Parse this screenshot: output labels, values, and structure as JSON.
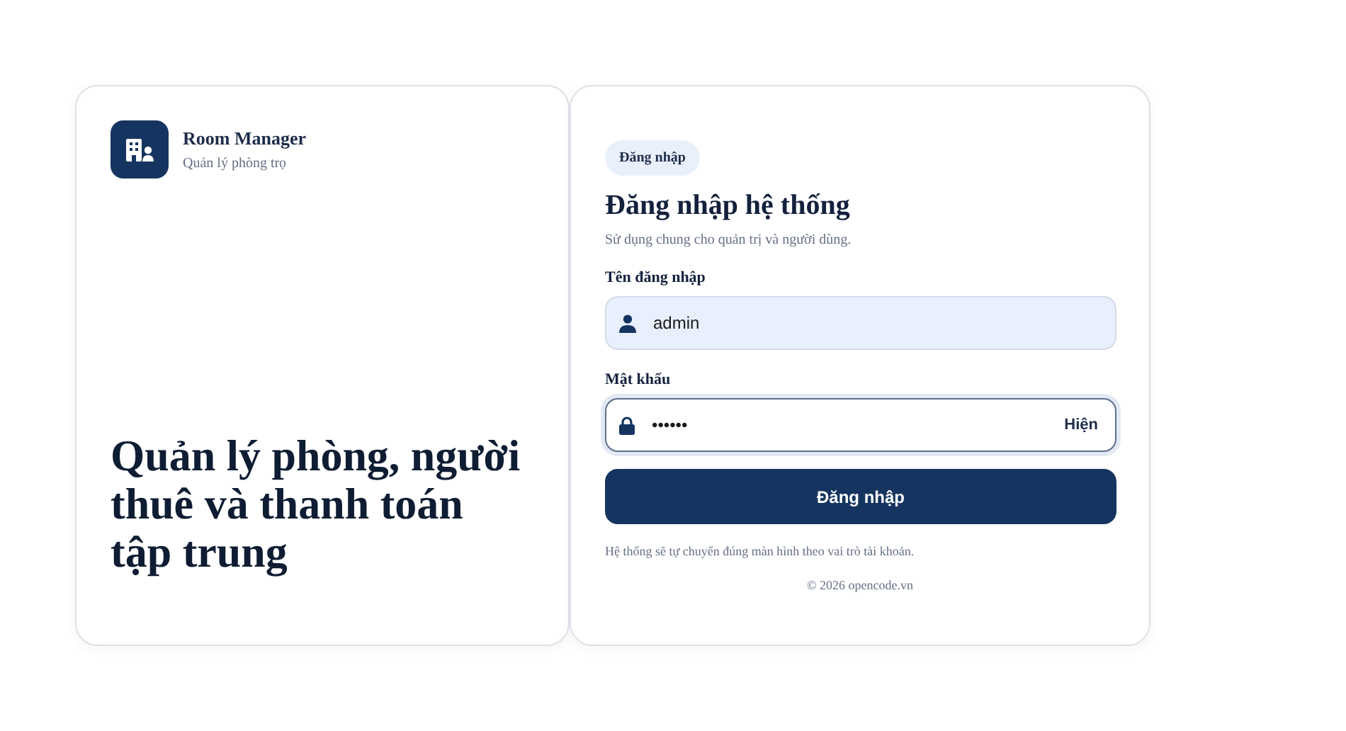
{
  "brand": {
    "name": "Room Manager",
    "subtitle": "Quản lý phòng trọ"
  },
  "hero": "Quản lý phòng, người thuê và thanh toán tập trung",
  "form": {
    "badge": "Đăng nhập",
    "title": "Đăng nhập hệ thống",
    "subtitle": "Sử dụng chung cho quản trị và người dùng.",
    "fields": [
      {
        "kind": "user",
        "label": "Tên đăng nhập",
        "value": "admin",
        "focused": false
      },
      {
        "kind": "password",
        "label": "Mật khẩu",
        "value": "••••••",
        "focused": true,
        "toggle": "Hiện"
      }
    ],
    "submit": "Đăng nhập",
    "note": "Hệ thống sẽ tự chuyển đúng màn hình theo vai trò tài khoản.",
    "footer": "© 2026 opencode.vn"
  }
}
